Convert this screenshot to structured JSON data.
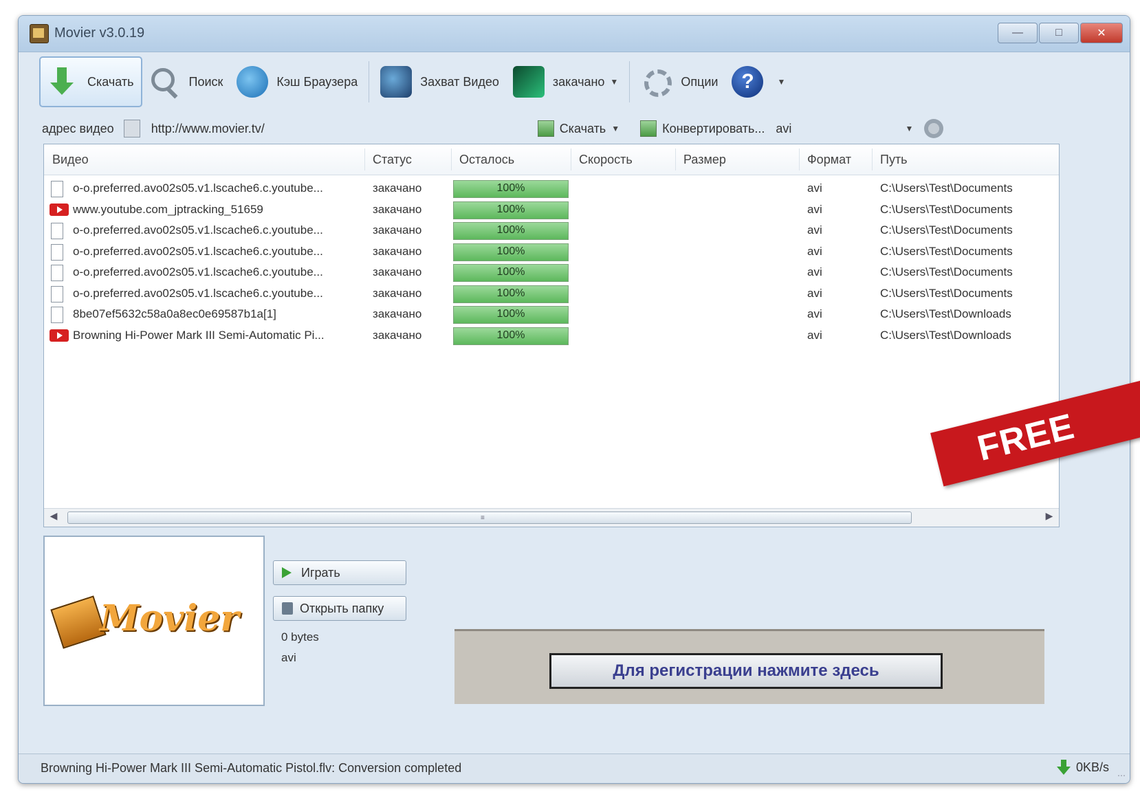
{
  "window": {
    "title": "Movier v3.0.19",
    "controls": [
      "minimize",
      "maximize",
      "close"
    ]
  },
  "toolbar": {
    "download_label": "Скачать",
    "search_label": "Поиск",
    "cache_label": "Кэш Браузера",
    "capture_label": "Захват Видео",
    "done_label": "закачано",
    "options_label": "Опции",
    "help_symbol": "?"
  },
  "address": {
    "label": "адрес видео",
    "value": "http://www.movier.tv/",
    "download_label": "Скачать",
    "convert_label": "Конвертировать...",
    "format_value": "avi"
  },
  "table": {
    "columns": [
      "Видео",
      "Статус",
      "Осталось",
      "Скорость",
      "Размер",
      "Формат",
      "Путь"
    ],
    "rows": [
      {
        "icon": "file-icon",
        "video": "o-o.preferred.avo02s05.v1.lscache6.c.youtube...",
        "status": "закачано",
        "progress": 1.0,
        "progress_label": "100%",
        "speed": "",
        "size": "",
        "format": "avi",
        "path": "C:\\Users\\Test\\Documents"
      },
      {
        "icon": "youtube-icon",
        "video": "www.youtube.com_jptracking_51659",
        "status": "закачано",
        "progress": 1.0,
        "progress_label": "100%",
        "speed": "",
        "size": "",
        "format": "avi",
        "path": "C:\\Users\\Test\\Documents"
      },
      {
        "icon": "file-icon",
        "video": "o-o.preferred.avo02s05.v1.lscache6.c.youtube...",
        "status": "закачано",
        "progress": 1.0,
        "progress_label": "100%",
        "speed": "",
        "size": "",
        "format": "avi",
        "path": "C:\\Users\\Test\\Documents"
      },
      {
        "icon": "file-icon",
        "video": "o-o.preferred.avo02s05.v1.lscache6.c.youtube...",
        "status": "закачано",
        "progress": 1.0,
        "progress_label": "100%",
        "speed": "",
        "size": "",
        "format": "avi",
        "path": "C:\\Users\\Test\\Documents"
      },
      {
        "icon": "file-icon",
        "video": "o-o.preferred.avo02s05.v1.lscache6.c.youtube...",
        "status": "закачано",
        "progress": 1.0,
        "progress_label": "100%",
        "speed": "",
        "size": "",
        "format": "avi",
        "path": "C:\\Users\\Test\\Documents"
      },
      {
        "icon": "file-icon",
        "video": "o-o.preferred.avo02s05.v1.lscache6.c.youtube...",
        "status": "закачано",
        "progress": 1.0,
        "progress_label": "100%",
        "speed": "",
        "size": "",
        "format": "avi",
        "path": "C:\\Users\\Test\\Documents"
      },
      {
        "icon": "file-icon",
        "video": "8be07ef5632c58a0a8ec0e69587b1a[1]",
        "status": "закачано",
        "progress": 1.0,
        "progress_label": "100%",
        "speed": "",
        "size": "",
        "format": "avi",
        "path": "C:\\Users\\Test\\Downloads"
      },
      {
        "icon": "youtube-icon",
        "video": "Browning Hi-Power Mark III Semi-Automatic Pi...",
        "status": "закачано",
        "progress": 1.0,
        "progress_label": "100%",
        "speed": "",
        "size": "",
        "format": "avi",
        "path": "C:\\Users\\Test\\Downloads"
      }
    ]
  },
  "banner": {
    "text": "FREE",
    "color": "#c8181d"
  },
  "preview": {
    "logo_text": "Movier",
    "play_label": "Играть",
    "open_folder_label": "Открыть папку",
    "size_text": "0 bytes",
    "format_text": "avi"
  },
  "registration": {
    "button_label": "Для регистрации нажмите здесь"
  },
  "status": {
    "message": "Browning Hi-Power Mark III Semi-Automatic Pistol.flv: Conversion completed",
    "speed": "0KB/s"
  },
  "colors": {
    "progress_fill": "#5db85c",
    "youtube_red": "#d62020",
    "window_bg": "#dfe9f3"
  }
}
